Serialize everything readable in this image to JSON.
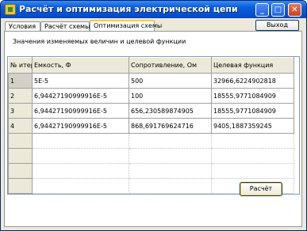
{
  "window": {
    "title": "Расчёт и оптимизация электрической цепи",
    "controls": {
      "minimize": "_",
      "maximize": "□",
      "close": "✕"
    }
  },
  "tabs": [
    {
      "label": "Условия",
      "active": false
    },
    {
      "label": "Расчёт схемы",
      "active": false
    },
    {
      "label": "Оптимизация схемы",
      "active": true
    }
  ],
  "exit_button": "Выход",
  "panel": {
    "caption": "Значения изменяемых величин и целевой функции",
    "grid": {
      "headers": [
        "№ итер",
        "Емкость, Ф",
        "Сопротивление, Ом",
        "Целевая функция"
      ],
      "rows": [
        [
          "1",
          "5E-5",
          "500",
          "32966,6224902818"
        ],
        [
          "2",
          "6,94427190999916E-5",
          "100",
          "18555,9771084909"
        ],
        [
          "3",
          "6,94427190999916E-5",
          "656,230589874905",
          "18555,9771084909"
        ],
        [
          "4",
          "6,94427190999916E-5",
          "868,691769624716",
          "9405,1887359245"
        ]
      ],
      "empty_rows": 4
    },
    "calc_button": "Расчёт"
  }
}
